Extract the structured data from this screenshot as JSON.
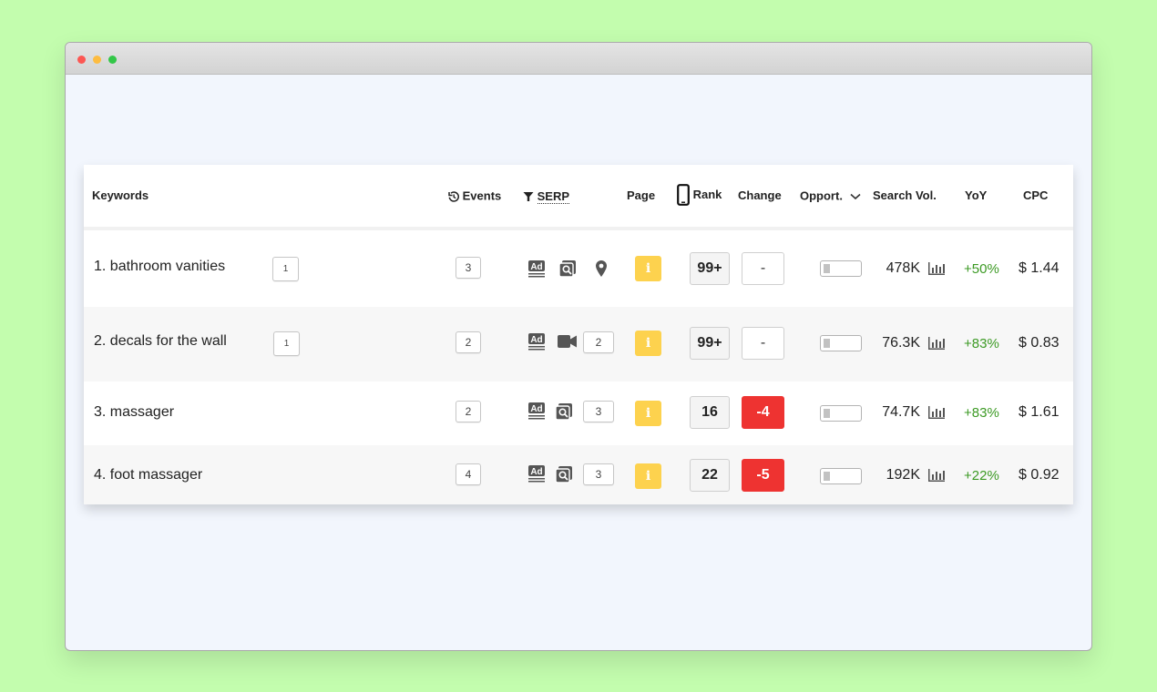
{
  "colors": {
    "background": "#c3fdae",
    "info_badge": "#fdd24e",
    "negative_change": "#ee3331",
    "positive_yoy": "#3c9a24"
  },
  "header": {
    "keywords": "Keywords",
    "events": "Events",
    "serp": "SERP",
    "page": "Page",
    "rank": "Rank",
    "change": "Change",
    "opport": "Opport.",
    "search_vol": "Search Vol.",
    "yoy": "YoY",
    "cpc": "CPC"
  },
  "rows": [
    {
      "number": "1.",
      "keyword": "bathroom vanities",
      "page_count": "1",
      "events": "3",
      "serp_icons": [
        "ad-icon",
        "image-icon",
        "map-pin-icon"
      ],
      "serp_count": "",
      "page_info": "i",
      "rank": "99+",
      "change": "-",
      "change_type": "neutral",
      "opportunity": 0.1,
      "search_volume": "478K",
      "yoy": "+50%",
      "cpc": "$ 1.44"
    },
    {
      "number": "2.",
      "keyword": "decals for the wall",
      "page_count": "1",
      "events": "2",
      "serp_icons": [
        "ad-icon",
        "video-icon"
      ],
      "serp_count": "2",
      "page_info": "i",
      "rank": "99+",
      "change": "-",
      "change_type": "neutral",
      "opportunity": 0.1,
      "search_volume": "76.3K",
      "yoy": "+83%",
      "cpc": "$ 0.83"
    },
    {
      "number": "3.",
      "keyword": "massager",
      "page_count": "",
      "events": "2",
      "serp_icons": [
        "ad-icon",
        "image-icon"
      ],
      "serp_count": "3",
      "page_info": "i",
      "rank": "16",
      "change": "-4",
      "change_type": "negative",
      "opportunity": 0.1,
      "search_volume": "74.7K",
      "yoy": "+83%",
      "cpc": "$ 1.61"
    },
    {
      "number": "4.",
      "keyword": "foot massager",
      "page_count": "",
      "events": "4",
      "serp_icons": [
        "ad-icon",
        "image-icon"
      ],
      "serp_count": "3",
      "page_info": "i",
      "rank": "22",
      "change": "-5",
      "change_type": "negative",
      "opportunity": 0.1,
      "search_volume": "192K",
      "yoy": "+22%",
      "cpc": "$ 0.92"
    }
  ]
}
